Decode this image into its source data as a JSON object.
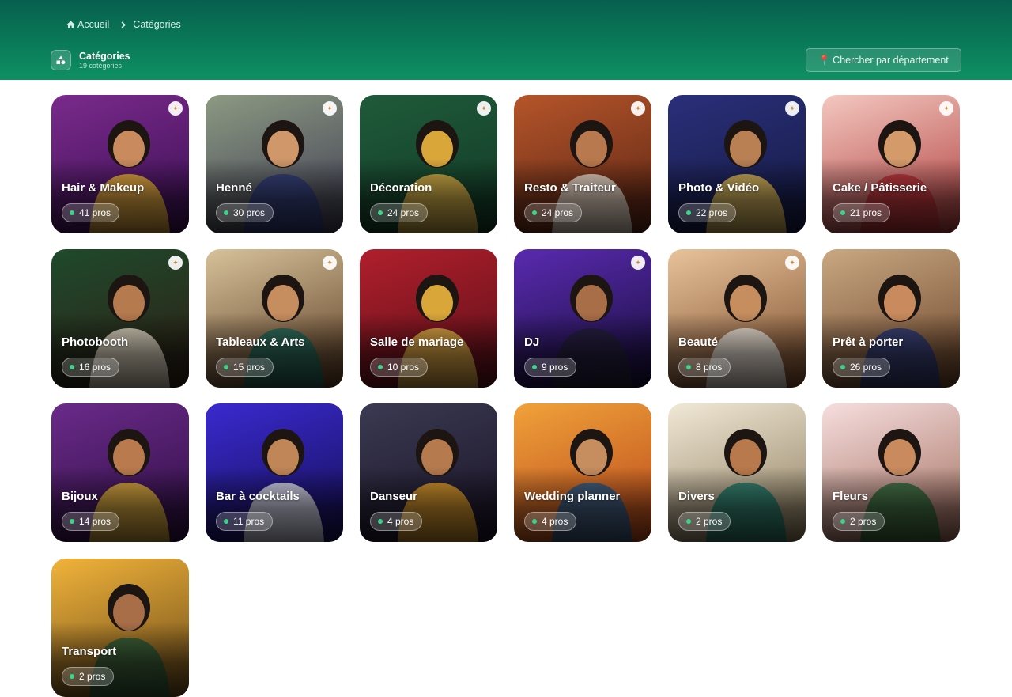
{
  "breadcrumb": {
    "home_label": "Accueil",
    "current_label": "Catégories"
  },
  "page": {
    "title": "Catégories",
    "subtitle": "19 catégories"
  },
  "department_button": {
    "icon": "pin-icon",
    "label": "Chercher par département"
  },
  "colors": {
    "header_dark": "#07604e",
    "header_light": "#0e9163",
    "online_dot": "#3ed38a"
  },
  "categories": [
    {
      "name": "Hair & Makeup",
      "count": "41 pros",
      "bg": [
        "#7a2a8c",
        "#3a0f52"
      ],
      "skin": "#c98b5e",
      "accent": "#f0b73a",
      "spark": true
    },
    {
      "name": "Henné",
      "count": "30 pros",
      "bg": [
        "#8c9a82",
        "#3d3a52"
      ],
      "skin": "#d0976a",
      "accent": "#2f3b7a",
      "spark": true
    },
    {
      "name": "Décoration",
      "count": "24 pros",
      "bg": [
        "#1f5a3a",
        "#123a26"
      ],
      "skin": "#d9a63a",
      "accent": "#e8b94a",
      "spark": true
    },
    {
      "name": "Resto & Traiteur",
      "count": "24 pros",
      "bg": [
        "#b5552a",
        "#5a2414"
      ],
      "skin": "#b9794e",
      "accent": "#f3e8d8",
      "spark": true
    },
    {
      "name": "Photo & Vidéo",
      "count": "22 pros",
      "bg": [
        "#2a2f7a",
        "#141a42"
      ],
      "skin": "#b98054",
      "accent": "#e8c25a",
      "spark": true
    },
    {
      "name": "Cake / Pâtisserie",
      "count": "21 pros",
      "bg": [
        "#f3c8c0",
        "#b03a3a"
      ],
      "skin": "#d49a6a",
      "accent": "#b82f35",
      "spark": true
    },
    {
      "name": "Photobooth",
      "count": "16 pros",
      "bg": [
        "#1f4a2c",
        "#2e1e14"
      ],
      "skin": "#b57a4e",
      "accent": "#f1e6d2",
      "spark": true
    },
    {
      "name": "Tableaux & Arts",
      "count": "15 pros",
      "bg": [
        "#d7c29a",
        "#5a3a22"
      ],
      "skin": "#c68d5f",
      "accent": "#1e6a5a",
      "spark": true
    },
    {
      "name": "Salle de mariage",
      "count": "10 pros",
      "bg": [
        "#b01f2c",
        "#5a0f18"
      ],
      "skin": "#d9a63a",
      "accent": "#e8b94a",
      "spark": false
    },
    {
      "name": "DJ",
      "count": "9 pros",
      "bg": [
        "#5a2ab0",
        "#160e3a"
      ],
      "skin": "#a86e48",
      "accent": "#24203a",
      "spark": true
    },
    {
      "name": "Beauté",
      "count": "8 pros",
      "bg": [
        "#e8c39a",
        "#7a4a2a"
      ],
      "skin": "#c68d5f",
      "accent": "#f5f0e8",
      "spark": true
    },
    {
      "name": "Prêt à porter",
      "count": "26 pros",
      "bg": [
        "#c9a882",
        "#6a4228"
      ],
      "skin": "#c98b5e",
      "accent": "#2a3a7a",
      "spark": false
    },
    {
      "name": "Bijoux",
      "count": "14 pros",
      "bg": [
        "#6a2a8a",
        "#2e0e42"
      ],
      "skin": "#b97a4e",
      "accent": "#e8b83a",
      "spark": false
    },
    {
      "name": "Bar à cocktails",
      "count": "11 pros",
      "bg": [
        "#3a2ad0",
        "#140e52"
      ],
      "skin": "#c08658",
      "accent": "#e8eaf2",
      "spark": false
    },
    {
      "name": "Danseur",
      "count": "4 pros",
      "bg": [
        "#3a3a52",
        "#1a1226"
      ],
      "skin": "#b57a4e",
      "accent": "#e8a22a",
      "spark": false
    },
    {
      "name": "Wedding planner",
      "count": "4 pros",
      "bg": [
        "#f0a23a",
        "#b8451a"
      ],
      "skin": "#c68d5f",
      "accent": "#2a5a8a",
      "spark": false
    },
    {
      "name": "Divers",
      "count": "2 pros",
      "bg": [
        "#f1e8d6",
        "#8a7a5a"
      ],
      "skin": "#b87a4c",
      "accent": "#1e7a6a",
      "spark": false
    },
    {
      "name": "Fleurs",
      "count": "2 pros",
      "bg": [
        "#f6dede",
        "#a06a5a"
      ],
      "skin": "#c98b5e",
      "accent": "#2f6a3a",
      "spark": false
    },
    {
      "name": "Transport",
      "count": "2 pros",
      "bg": [
        "#f1b33a",
        "#6a4a1a"
      ],
      "skin": "#a86e48",
      "accent": "#2a5a3a",
      "spark": false
    }
  ]
}
